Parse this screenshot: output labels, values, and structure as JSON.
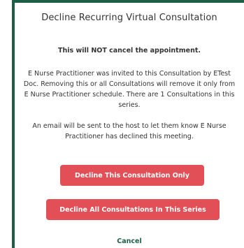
{
  "dialog": {
    "title": "Decline Recurring Virtual Consultation",
    "warning": "This will NOT cancel the appointment.",
    "paragraph1": [
      "E Nurse Practitioner was invited to this Consultation by ETest",
      "Doc. Removing this or all Consultations will remove it only from",
      "E Nurse Practitioner schedule. There are 1 Consultations in this",
      "series."
    ],
    "paragraph2": [
      "An email will be sent to the host to let them know E Nurse",
      "Practitioner has declined this meeting."
    ],
    "decline_only_label": "Decline This Consultation Only",
    "decline_all_label": "Decline All Consultations In This Series",
    "cancel_label": "Cancel"
  },
  "colors": {
    "accent": "#1f5e46",
    "danger": "#e24f56"
  }
}
